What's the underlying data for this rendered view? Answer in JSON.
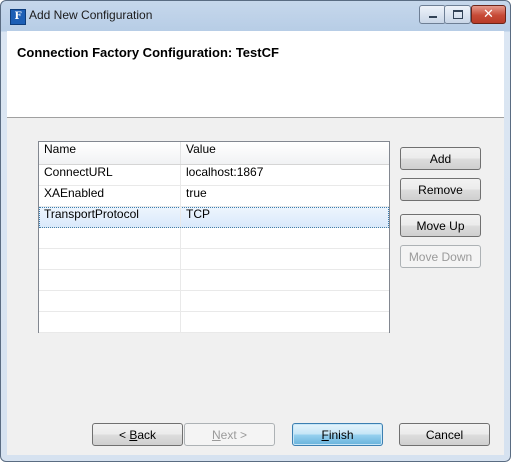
{
  "window": {
    "title": "Add New Configuration",
    "icon_letter": "F"
  },
  "banner": {
    "title": "Connection Factory Configuration: TestCF"
  },
  "table": {
    "columns": [
      "Name",
      "Value"
    ],
    "rows": [
      {
        "name": "ConnectURL",
        "value": "localhost:1867"
      },
      {
        "name": "XAEnabled",
        "value": "true"
      },
      {
        "name": "TransportProtocol",
        "value": "TCP"
      },
      {
        "name": "",
        "value": ""
      },
      {
        "name": "",
        "value": ""
      },
      {
        "name": "",
        "value": ""
      },
      {
        "name": "",
        "value": ""
      },
      {
        "name": "",
        "value": ""
      }
    ],
    "selected_row": 2
  },
  "side_buttons": {
    "add": "Add",
    "remove": "Remove",
    "move_up": "Move Up",
    "move_down": "Move Down"
  },
  "footer": {
    "back": {
      "mnemonic": "B",
      "rest": "ack",
      "prefix": "< "
    },
    "next": {
      "mnemonic": "N",
      "rest": "ext",
      "suffix": " >"
    },
    "finish": {
      "mnemonic": "F",
      "rest": "inish"
    },
    "cancel": "Cancel"
  },
  "colors": {
    "selection": "#d9e9fb",
    "default_button": "#68b3db",
    "title_bar": "#c6d7eb"
  }
}
